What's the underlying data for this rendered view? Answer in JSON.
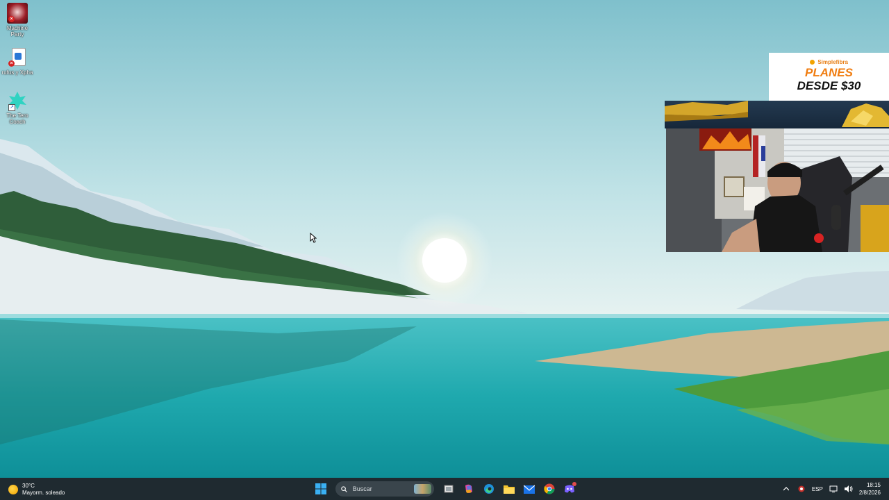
{
  "desktop": {
    "icons": [
      {
        "label_line1": "Machine",
        "label_line2": "Party",
        "icon": "game-shortcut-icon"
      },
      {
        "label_line1": "rufus y Xpha",
        "label_line2": "",
        "icon": "file-shortcut-icon"
      },
      {
        "label_line1": "The Tero",
        "label_line2": "Coach",
        "icon": "app-shortcut-icon"
      }
    ]
  },
  "ad": {
    "brand": "Simplefibra",
    "line1": "PLANES",
    "line2": "DESDE $30"
  },
  "taskbar": {
    "weather": {
      "temp": "30°C",
      "condition": "Mayorm. soleado"
    },
    "search": {
      "placeholder": "Buscar"
    },
    "pinned": [
      "start-icon",
      "task-view-icon",
      "copilot-icon",
      "edge-icon",
      "file-explorer-icon",
      "mail-icon",
      "chrome-icon",
      "discord-icon"
    ],
    "tray": {
      "language": "ESP"
    },
    "clock": {
      "time": "18:15",
      "date": "2/8/2026"
    }
  },
  "colors": {
    "taskbar_bg": "#1f2a30",
    "ad_orange": "#f07d11"
  }
}
